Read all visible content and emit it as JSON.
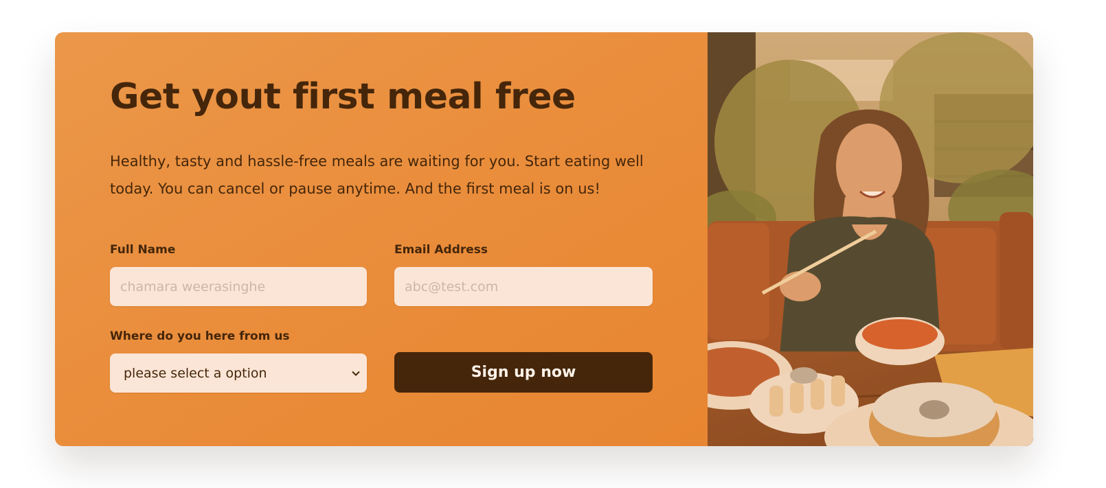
{
  "cta": {
    "heading": "Get yout first meal free",
    "text": "Healthy, tasty and hassle-free meals are waiting for you. Start eating well today. You can cancel or pause anytime. And the first meal is on us!"
  },
  "form": {
    "full_name": {
      "label": "Full Name",
      "placeholder": "chamara weerasinghe"
    },
    "email": {
      "label": "Email Address",
      "placeholder": "abc@test.com"
    },
    "source": {
      "label": "Where do you here from us",
      "selected": "please select a option",
      "icon": "chevron-down-icon"
    },
    "submit_label": "Sign up now"
  },
  "image": {
    "alt": "Woman enjoying a healthy meal"
  },
  "colors": {
    "card_bg": "#e98a37",
    "text_dark": "#45260a",
    "input_bg": "#fbe5d6",
    "button_bg": "#45260a"
  }
}
